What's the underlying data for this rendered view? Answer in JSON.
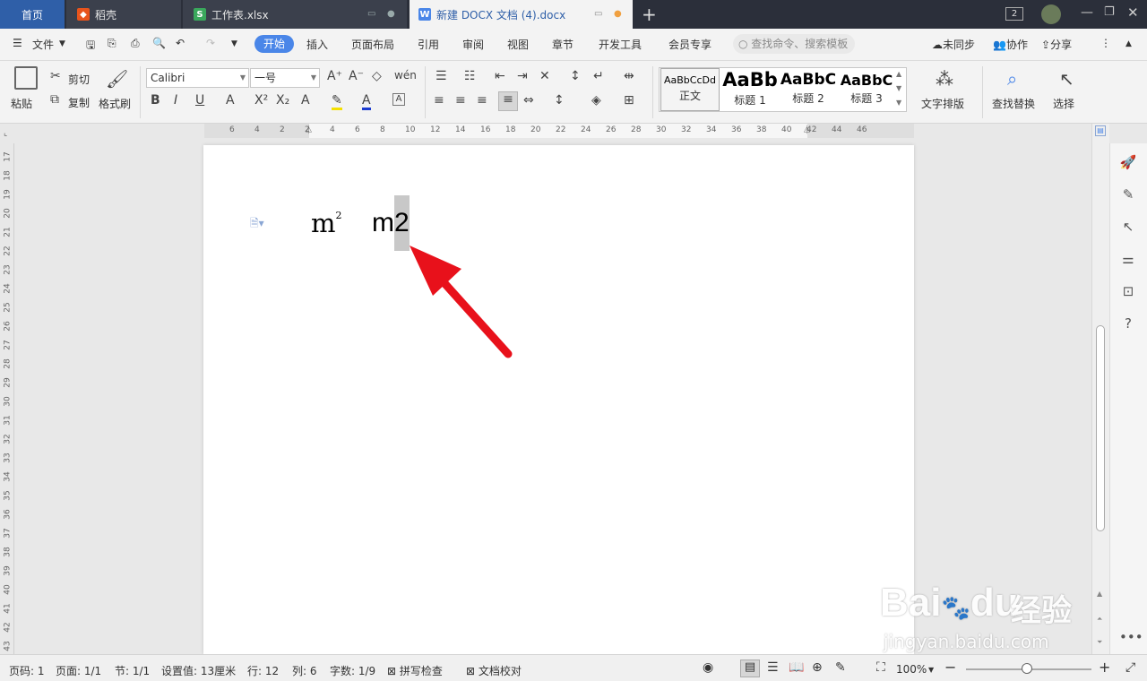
{
  "tabs": {
    "home": "首页",
    "t1": "稻壳",
    "t2": "工作表.xlsx",
    "t3": "新建 DOCX 文档 (4).docx",
    "add": "+",
    "badge": "2"
  },
  "menubar": {
    "file": "文件",
    "items": [
      "开始",
      "插入",
      "页面布局",
      "引用",
      "审阅",
      "视图",
      "章节",
      "开发工具",
      "会员专享"
    ],
    "search": "查找命令、搜索模板",
    "sync": "未同步",
    "collab": "协作",
    "share": "分享"
  },
  "ribbon": {
    "paste": "粘贴",
    "cut": "剪切",
    "copy": "复制",
    "format_painter": "格式刷",
    "font": "Calibri",
    "size": "一号",
    "styles": [
      {
        "preview": "AaBbCcDd",
        "name": "正文"
      },
      {
        "preview": "AaBb",
        "name": "标题 1"
      },
      {
        "preview": "AaBbC",
        "name": "标题 2"
      },
      {
        "preview": "AaBbC",
        "name": "标题 3"
      }
    ],
    "text_layout": "文字排版",
    "find_replace": "查找替换",
    "select": "选择"
  },
  "hruler_ticks": [
    "6",
    "4",
    "2",
    "2",
    "4",
    "6",
    "8",
    "10",
    "12",
    "14",
    "16",
    "18",
    "20",
    "22",
    "24",
    "26",
    "28",
    "30",
    "32",
    "34",
    "36",
    "38",
    "40",
    "42",
    "44",
    "46"
  ],
  "vruler_ticks": [
    "17",
    "18",
    "19",
    "20",
    "21",
    "22",
    "23",
    "24",
    "25",
    "26",
    "27",
    "28",
    "29",
    "30",
    "31",
    "32",
    "33",
    "34",
    "35",
    "36",
    "37",
    "38",
    "39",
    "40",
    "41",
    "42",
    "43"
  ],
  "document": {
    "m_sup_base": "m",
    "m_sup_exp": "2",
    "m_plain_base": "m",
    "m_plain_digit": "2"
  },
  "status": {
    "page": "页码: 1",
    "pages": "页面: 1/1",
    "section": "节: 1/1",
    "setting": "设置值: 13厘米",
    "row": "行: 12",
    "col": "列: 6",
    "words": "字数: 1/9",
    "spell": "拼写检查",
    "proof": "文档校对",
    "zoom": "100%"
  },
  "watermark": {
    "brand": "Bai",
    "brand2": "du",
    "cn": "经验",
    "url": "jingyan.baidu.com"
  },
  "colors": {
    "accent": "#4a86e8",
    "arrow": "#e8111b",
    "tabbar": "#2b2f3a"
  }
}
